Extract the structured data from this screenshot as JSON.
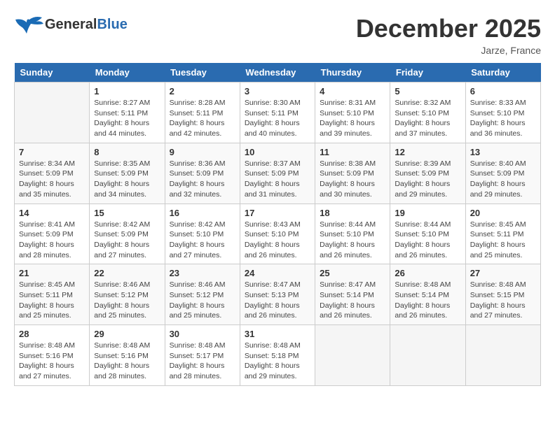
{
  "header": {
    "logo_general": "General",
    "logo_blue": "Blue",
    "month": "December 2025",
    "location": "Jarze, France"
  },
  "calendar": {
    "days_of_week": [
      "Sunday",
      "Monday",
      "Tuesday",
      "Wednesday",
      "Thursday",
      "Friday",
      "Saturday"
    ],
    "weeks": [
      [
        {
          "day": "",
          "sunrise": "",
          "sunset": "",
          "daylight": ""
        },
        {
          "day": "1",
          "sunrise": "Sunrise: 8:27 AM",
          "sunset": "Sunset: 5:11 PM",
          "daylight": "Daylight: 8 hours and 44 minutes."
        },
        {
          "day": "2",
          "sunrise": "Sunrise: 8:28 AM",
          "sunset": "Sunset: 5:11 PM",
          "daylight": "Daylight: 8 hours and 42 minutes."
        },
        {
          "day": "3",
          "sunrise": "Sunrise: 8:30 AM",
          "sunset": "Sunset: 5:11 PM",
          "daylight": "Daylight: 8 hours and 40 minutes."
        },
        {
          "day": "4",
          "sunrise": "Sunrise: 8:31 AM",
          "sunset": "Sunset: 5:10 PM",
          "daylight": "Daylight: 8 hours and 39 minutes."
        },
        {
          "day": "5",
          "sunrise": "Sunrise: 8:32 AM",
          "sunset": "Sunset: 5:10 PM",
          "daylight": "Daylight: 8 hours and 37 minutes."
        },
        {
          "day": "6",
          "sunrise": "Sunrise: 8:33 AM",
          "sunset": "Sunset: 5:10 PM",
          "daylight": "Daylight: 8 hours and 36 minutes."
        }
      ],
      [
        {
          "day": "7",
          "sunrise": "Sunrise: 8:34 AM",
          "sunset": "Sunset: 5:09 PM",
          "daylight": "Daylight: 8 hours and 35 minutes."
        },
        {
          "day": "8",
          "sunrise": "Sunrise: 8:35 AM",
          "sunset": "Sunset: 5:09 PM",
          "daylight": "Daylight: 8 hours and 34 minutes."
        },
        {
          "day": "9",
          "sunrise": "Sunrise: 8:36 AM",
          "sunset": "Sunset: 5:09 PM",
          "daylight": "Daylight: 8 hours and 32 minutes."
        },
        {
          "day": "10",
          "sunrise": "Sunrise: 8:37 AM",
          "sunset": "Sunset: 5:09 PM",
          "daylight": "Daylight: 8 hours and 31 minutes."
        },
        {
          "day": "11",
          "sunrise": "Sunrise: 8:38 AM",
          "sunset": "Sunset: 5:09 PM",
          "daylight": "Daylight: 8 hours and 30 minutes."
        },
        {
          "day": "12",
          "sunrise": "Sunrise: 8:39 AM",
          "sunset": "Sunset: 5:09 PM",
          "daylight": "Daylight: 8 hours and 29 minutes."
        },
        {
          "day": "13",
          "sunrise": "Sunrise: 8:40 AM",
          "sunset": "Sunset: 5:09 PM",
          "daylight": "Daylight: 8 hours and 29 minutes."
        }
      ],
      [
        {
          "day": "14",
          "sunrise": "Sunrise: 8:41 AM",
          "sunset": "Sunset: 5:09 PM",
          "daylight": "Daylight: 8 hours and 28 minutes."
        },
        {
          "day": "15",
          "sunrise": "Sunrise: 8:42 AM",
          "sunset": "Sunset: 5:09 PM",
          "daylight": "Daylight: 8 hours and 27 minutes."
        },
        {
          "day": "16",
          "sunrise": "Sunrise: 8:42 AM",
          "sunset": "Sunset: 5:10 PM",
          "daylight": "Daylight: 8 hours and 27 minutes."
        },
        {
          "day": "17",
          "sunrise": "Sunrise: 8:43 AM",
          "sunset": "Sunset: 5:10 PM",
          "daylight": "Daylight: 8 hours and 26 minutes."
        },
        {
          "day": "18",
          "sunrise": "Sunrise: 8:44 AM",
          "sunset": "Sunset: 5:10 PM",
          "daylight": "Daylight: 8 hours and 26 minutes."
        },
        {
          "day": "19",
          "sunrise": "Sunrise: 8:44 AM",
          "sunset": "Sunset: 5:10 PM",
          "daylight": "Daylight: 8 hours and 26 minutes."
        },
        {
          "day": "20",
          "sunrise": "Sunrise: 8:45 AM",
          "sunset": "Sunset: 5:11 PM",
          "daylight": "Daylight: 8 hours and 25 minutes."
        }
      ],
      [
        {
          "day": "21",
          "sunrise": "Sunrise: 8:45 AM",
          "sunset": "Sunset: 5:11 PM",
          "daylight": "Daylight: 8 hours and 25 minutes."
        },
        {
          "day": "22",
          "sunrise": "Sunrise: 8:46 AM",
          "sunset": "Sunset: 5:12 PM",
          "daylight": "Daylight: 8 hours and 25 minutes."
        },
        {
          "day": "23",
          "sunrise": "Sunrise: 8:46 AM",
          "sunset": "Sunset: 5:12 PM",
          "daylight": "Daylight: 8 hours and 25 minutes."
        },
        {
          "day": "24",
          "sunrise": "Sunrise: 8:47 AM",
          "sunset": "Sunset: 5:13 PM",
          "daylight": "Daylight: 8 hours and 26 minutes."
        },
        {
          "day": "25",
          "sunrise": "Sunrise: 8:47 AM",
          "sunset": "Sunset: 5:14 PM",
          "daylight": "Daylight: 8 hours and 26 minutes."
        },
        {
          "day": "26",
          "sunrise": "Sunrise: 8:48 AM",
          "sunset": "Sunset: 5:14 PM",
          "daylight": "Daylight: 8 hours and 26 minutes."
        },
        {
          "day": "27",
          "sunrise": "Sunrise: 8:48 AM",
          "sunset": "Sunset: 5:15 PM",
          "daylight": "Daylight: 8 hours and 27 minutes."
        }
      ],
      [
        {
          "day": "28",
          "sunrise": "Sunrise: 8:48 AM",
          "sunset": "Sunset: 5:16 PM",
          "daylight": "Daylight: 8 hours and 27 minutes."
        },
        {
          "day": "29",
          "sunrise": "Sunrise: 8:48 AM",
          "sunset": "Sunset: 5:16 PM",
          "daylight": "Daylight: 8 hours and 28 minutes."
        },
        {
          "day": "30",
          "sunrise": "Sunrise: 8:48 AM",
          "sunset": "Sunset: 5:17 PM",
          "daylight": "Daylight: 8 hours and 28 minutes."
        },
        {
          "day": "31",
          "sunrise": "Sunrise: 8:48 AM",
          "sunset": "Sunset: 5:18 PM",
          "daylight": "Daylight: 8 hours and 29 minutes."
        },
        {
          "day": "",
          "sunrise": "",
          "sunset": "",
          "daylight": ""
        },
        {
          "day": "",
          "sunrise": "",
          "sunset": "",
          "daylight": ""
        },
        {
          "day": "",
          "sunrise": "",
          "sunset": "",
          "daylight": ""
        }
      ]
    ]
  }
}
